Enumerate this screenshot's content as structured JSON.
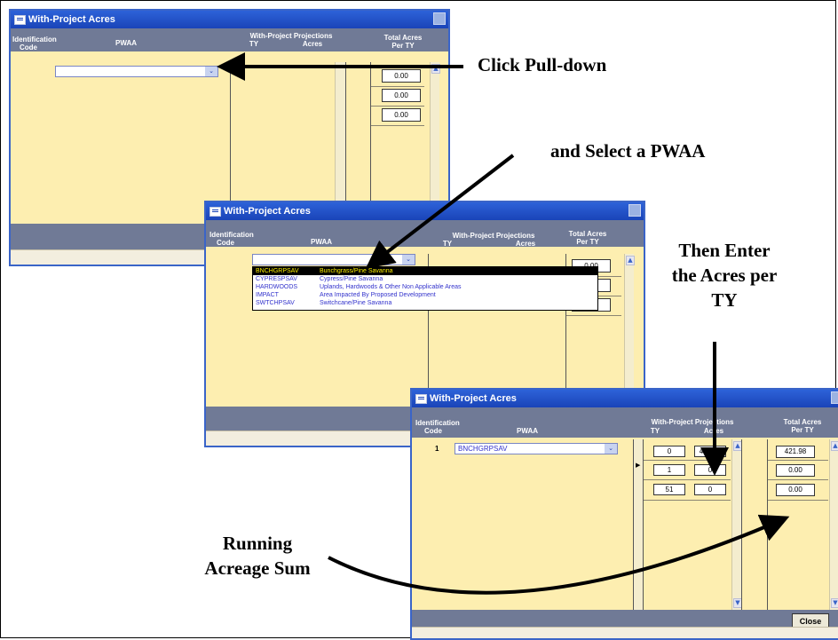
{
  "windows": {
    "title": "With-Project Acres",
    "close_glyph": "✕",
    "col_id": "Identification\nCode",
    "col_pwaa": "PWAA",
    "col_proj": "With-Project Projections",
    "col_ty": "TY",
    "col_acres": "Acres",
    "col_total": "Total Acres\nPer TY"
  },
  "window1": {
    "totals": [
      "0.00",
      "0.00",
      "0.00"
    ]
  },
  "window2": {
    "totals": [
      "0.00",
      "0.00",
      "0.00"
    ],
    "dropdown_options": [
      {
        "code": "BNCHGRPSAV",
        "name": "Bunchgrass/Pine Savanna"
      },
      {
        "code": "CYPRESPSAV",
        "name": "Cypress/Pine Savanna"
      },
      {
        "code": "HARDWOODS",
        "name": "Uplands, Hardwoods & Other Non Applicable Areas"
      },
      {
        "code": "IMPACT",
        "name": "Area Impacted By Proposed Development"
      },
      {
        "code": "SWTCHPSAV",
        "name": "Switchcane/Pine Savanna"
      }
    ]
  },
  "window3": {
    "row_number": "1",
    "pwaa_value": "BNCHGRPSAV",
    "rows": [
      {
        "ty": "0",
        "acres": "421.98"
      },
      {
        "ty": "1",
        "acres": "0"
      },
      {
        "ty": "51",
        "acres": "0"
      }
    ],
    "totals": [
      "421.98",
      "0.00",
      "0.00"
    ],
    "close_label": "Close"
  },
  "glyphs": {
    "combo_arrow": "⌄",
    "scroll_up": "▲",
    "scroll_down": "▼",
    "row_pointer": "▶"
  },
  "annotations": {
    "click_pulldown": "Click Pull-down",
    "select_pwaa": "and Select a PWAA",
    "enter_acres": "Then Enter\nthe Acres per\nTY",
    "running_sum": "Running\nAcreage Sum"
  },
  "icons": {
    "window_icon": "form-icon",
    "close_icon": "close-icon",
    "dropdown_icon": "chevron-down-icon"
  },
  "colors": {
    "title_bar": "#1a44b8",
    "form_background": "#fdeeb0",
    "status_bar": "#707a96",
    "dropdown_selected_bg": "#000000",
    "dropdown_selected_text": "#fff200",
    "dropdown_text": "#3333cc"
  }
}
